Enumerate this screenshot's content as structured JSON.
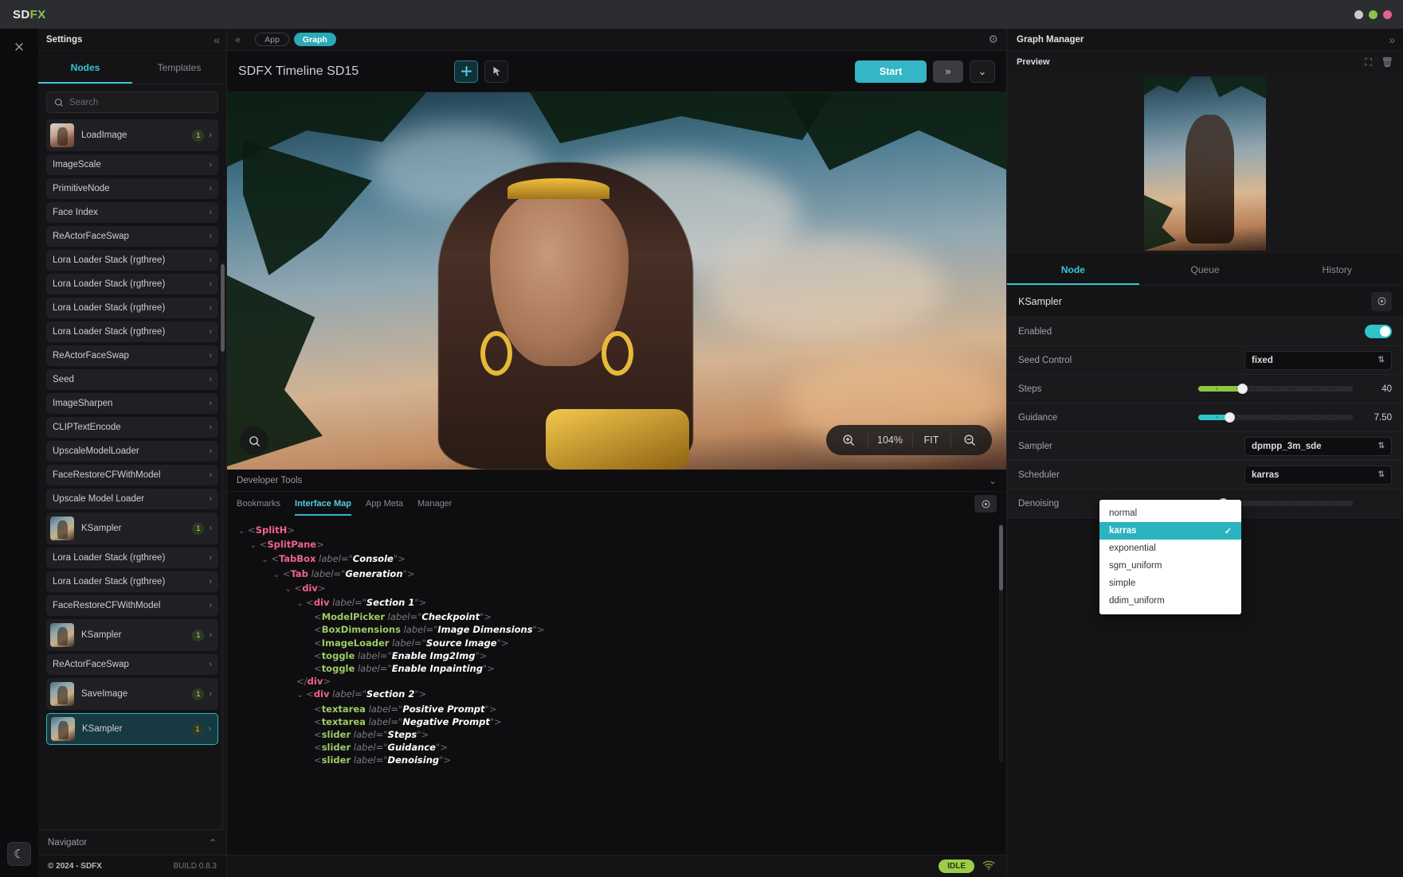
{
  "window": {
    "logo_sd": "SD",
    "logo_fx": "FX",
    "buttons": [
      "minimize",
      "maximize",
      "close"
    ],
    "button_colors": [
      "#c9c9cf",
      "#8bc34a",
      "#e0648f"
    ]
  },
  "rail": {
    "close_icon": "close-icon",
    "theme_icon": "moon-icon"
  },
  "sidebar": {
    "title": "Settings",
    "collapse_icon": "chevron-double-left-icon",
    "tabs": [
      {
        "label": "Nodes",
        "active": true
      },
      {
        "label": "Templates",
        "active": false
      }
    ],
    "search": {
      "placeholder": "Search",
      "value": "",
      "icon": "search-icon"
    },
    "nodes": [
      {
        "label": "LoadImage",
        "badge": "1",
        "thumb": true,
        "selected": false
      },
      {
        "label": "ImageScale",
        "badge": "",
        "thumb": false,
        "selected": false
      },
      {
        "label": "PrimitiveNode",
        "badge": "",
        "thumb": false,
        "selected": false
      },
      {
        "label": "Face Index",
        "badge": "",
        "thumb": false,
        "selected": false
      },
      {
        "label": "ReActorFaceSwap",
        "badge": "",
        "thumb": false,
        "selected": false
      },
      {
        "label": "Lora Loader Stack (rgthree)",
        "badge": "",
        "thumb": false,
        "selected": false
      },
      {
        "label": "Lora Loader Stack (rgthree)",
        "badge": "",
        "thumb": false,
        "selected": false
      },
      {
        "label": "Lora Loader Stack (rgthree)",
        "badge": "",
        "thumb": false,
        "selected": false
      },
      {
        "label": "Lora Loader Stack (rgthree)",
        "badge": "",
        "thumb": false,
        "selected": false
      },
      {
        "label": "ReActorFaceSwap",
        "badge": "",
        "thumb": false,
        "selected": false
      },
      {
        "label": "Seed",
        "badge": "",
        "thumb": false,
        "selected": false
      },
      {
        "label": "ImageSharpen",
        "badge": "",
        "thumb": false,
        "selected": false
      },
      {
        "label": "CLIPTextEncode",
        "badge": "",
        "thumb": false,
        "selected": false
      },
      {
        "label": "UpscaleModelLoader",
        "badge": "",
        "thumb": false,
        "selected": false
      },
      {
        "label": "FaceRestoreCFWithModel",
        "badge": "",
        "thumb": false,
        "selected": false
      },
      {
        "label": "Upscale Model Loader",
        "badge": "",
        "thumb": false,
        "selected": false
      },
      {
        "label": "KSampler",
        "badge": "1",
        "thumb": true,
        "selected": false
      },
      {
        "label": "Lora Loader Stack (rgthree)",
        "badge": "",
        "thumb": false,
        "selected": false
      },
      {
        "label": "Lora Loader Stack (rgthree)",
        "badge": "",
        "thumb": false,
        "selected": false
      },
      {
        "label": "FaceRestoreCFWithModel",
        "badge": "",
        "thumb": false,
        "selected": false
      },
      {
        "label": "KSampler",
        "badge": "1",
        "thumb": true,
        "selected": false
      },
      {
        "label": "ReActorFaceSwap",
        "badge": "",
        "thumb": false,
        "selected": false
      },
      {
        "label": "SaveImage",
        "badge": "1",
        "thumb": true,
        "selected": false
      },
      {
        "label": "KSampler",
        "badge": "1",
        "thumb": true,
        "selected": true
      }
    ],
    "navigator": {
      "label": "Navigator",
      "chev_icon": "chevron-up-icon"
    },
    "footer": {
      "copyright": "© 2024 - SDFX",
      "build": "BUILD 0.8.3"
    }
  },
  "center": {
    "mode_tabs": [
      {
        "label": "App",
        "active": false
      },
      {
        "label": "Graph",
        "active": true
      }
    ],
    "gear_icon": "gear-icon",
    "graph_title": "SDFX Timeline SD15",
    "tools": [
      {
        "name": "pan-tool",
        "icon": "move-icon",
        "active": true
      },
      {
        "name": "select-tool",
        "icon": "cursor-icon",
        "active": false
      }
    ],
    "start_label": "Start",
    "queue_icon": "double-chevron-right-icon",
    "more_icon": "chevron-down-icon",
    "canvas": {
      "search_icon": "search-icon",
      "zoom_in_icon": "zoom-in-icon",
      "zoom_level": "104%",
      "fit_label": "FIT",
      "zoom_out_icon": "zoom-out-icon"
    },
    "devtools": {
      "title": "Developer Tools",
      "collapse_icon": "chevron-down-icon",
      "tabs": [
        {
          "label": "Bookmarks",
          "active": false
        },
        {
          "label": "Interface Map",
          "active": true
        },
        {
          "label": "App Meta",
          "active": false
        },
        {
          "label": "Manager",
          "active": false
        }
      ],
      "locate_icon": "target-icon",
      "tree": [
        {
          "indent": 0,
          "caret": true,
          "tag": "SplitH",
          "kind": "a",
          "attr": "",
          "value": "",
          "close": false
        },
        {
          "indent": 1,
          "caret": true,
          "tag": "SplitPane",
          "kind": "a",
          "attr": "",
          "value": "",
          "close": false
        },
        {
          "indent": 2,
          "caret": true,
          "tag": "TabBox",
          "kind": "a",
          "attr": "label",
          "value": "Console",
          "close": false
        },
        {
          "indent": 3,
          "caret": true,
          "tag": "Tab",
          "kind": "a",
          "attr": "label",
          "value": "Generation",
          "close": false
        },
        {
          "indent": 4,
          "caret": true,
          "tag": "div",
          "kind": "a",
          "attr": "",
          "value": "",
          "close": false
        },
        {
          "indent": 5,
          "caret": true,
          "tag": "div",
          "kind": "a",
          "attr": "label",
          "value": "Section 1",
          "close": false
        },
        {
          "indent": 6,
          "caret": false,
          "tag": "ModelPicker",
          "kind": "b",
          "attr": "label",
          "value": "Checkpoint",
          "close": false
        },
        {
          "indent": 6,
          "caret": false,
          "tag": "BoxDimensions",
          "kind": "b",
          "attr": "label",
          "value": "Image Dimensions",
          "close": false
        },
        {
          "indent": 6,
          "caret": false,
          "tag": "ImageLoader",
          "kind": "b",
          "attr": "label",
          "value": "Source Image",
          "close": false
        },
        {
          "indent": 6,
          "caret": false,
          "tag": "toggle",
          "kind": "b",
          "attr": "label",
          "value": "Enable Img2Img",
          "close": false
        },
        {
          "indent": 6,
          "caret": false,
          "tag": "toggle",
          "kind": "b",
          "attr": "label",
          "value": "Enable Inpainting",
          "close": false
        },
        {
          "indent": 5,
          "caret": false,
          "tag": "div",
          "kind": "a",
          "attr": "",
          "value": "",
          "close": true
        },
        {
          "indent": 5,
          "caret": true,
          "tag": "div",
          "kind": "a",
          "attr": "label",
          "value": "Section 2",
          "close": false
        },
        {
          "indent": 6,
          "caret": false,
          "tag": "textarea",
          "kind": "b",
          "attr": "label",
          "value": "Positive Prompt",
          "close": false
        },
        {
          "indent": 6,
          "caret": false,
          "tag": "textarea",
          "kind": "b",
          "attr": "label",
          "value": "Negative Prompt",
          "close": false
        },
        {
          "indent": 6,
          "caret": false,
          "tag": "slider",
          "kind": "b",
          "attr": "label",
          "value": "Steps",
          "close": false
        },
        {
          "indent": 6,
          "caret": false,
          "tag": "slider",
          "kind": "b",
          "attr": "label",
          "value": "Guidance",
          "close": false
        },
        {
          "indent": 6,
          "caret": false,
          "tag": "slider",
          "kind": "b",
          "attr": "label",
          "value": "Denoising",
          "close": false
        }
      ]
    },
    "status": {
      "badge": "IDLE",
      "wifi_icon": "wifi-icon"
    }
  },
  "right": {
    "title": "Graph Manager",
    "expand_icon": "chevron-double-right-icon",
    "preview": {
      "label": "Preview",
      "actions": [
        "expand-icon",
        "trash-icon"
      ]
    },
    "tabs": [
      {
        "label": "Node",
        "active": true
      },
      {
        "label": "Queue",
        "active": false
      },
      {
        "label": "History",
        "active": false
      }
    ],
    "node_name": "KSampler",
    "node_action_icon": "target-icon",
    "properties": [
      {
        "label": "Enabled",
        "type": "toggle",
        "value": "on"
      },
      {
        "label": "Seed Control",
        "type": "select",
        "value": "fixed"
      },
      {
        "label": "Steps",
        "type": "slider",
        "value": "40",
        "percent": 28,
        "color": "#8dc63f"
      },
      {
        "label": "Guidance",
        "type": "slider",
        "value": "7.50",
        "percent": 20,
        "color": "#2ec4c9"
      },
      {
        "label": "Sampler",
        "type": "select",
        "value": "dpmpp_3m_sde"
      },
      {
        "label": "Scheduler",
        "type": "select",
        "value": "karras"
      },
      {
        "label": "Denoising",
        "type": "slider",
        "value": "",
        "percent": 16,
        "color": "#e8497f"
      }
    ],
    "dropdown": {
      "open_for": "Scheduler",
      "options": [
        {
          "label": "normal",
          "selected": false
        },
        {
          "label": "karras",
          "selected": true
        },
        {
          "label": "exponential",
          "selected": false
        },
        {
          "label": "sgm_uniform",
          "selected": false
        },
        {
          "label": "simple",
          "selected": false
        },
        {
          "label": "ddim_uniform",
          "selected": false
        }
      ],
      "check_icon": "check-icon"
    }
  }
}
